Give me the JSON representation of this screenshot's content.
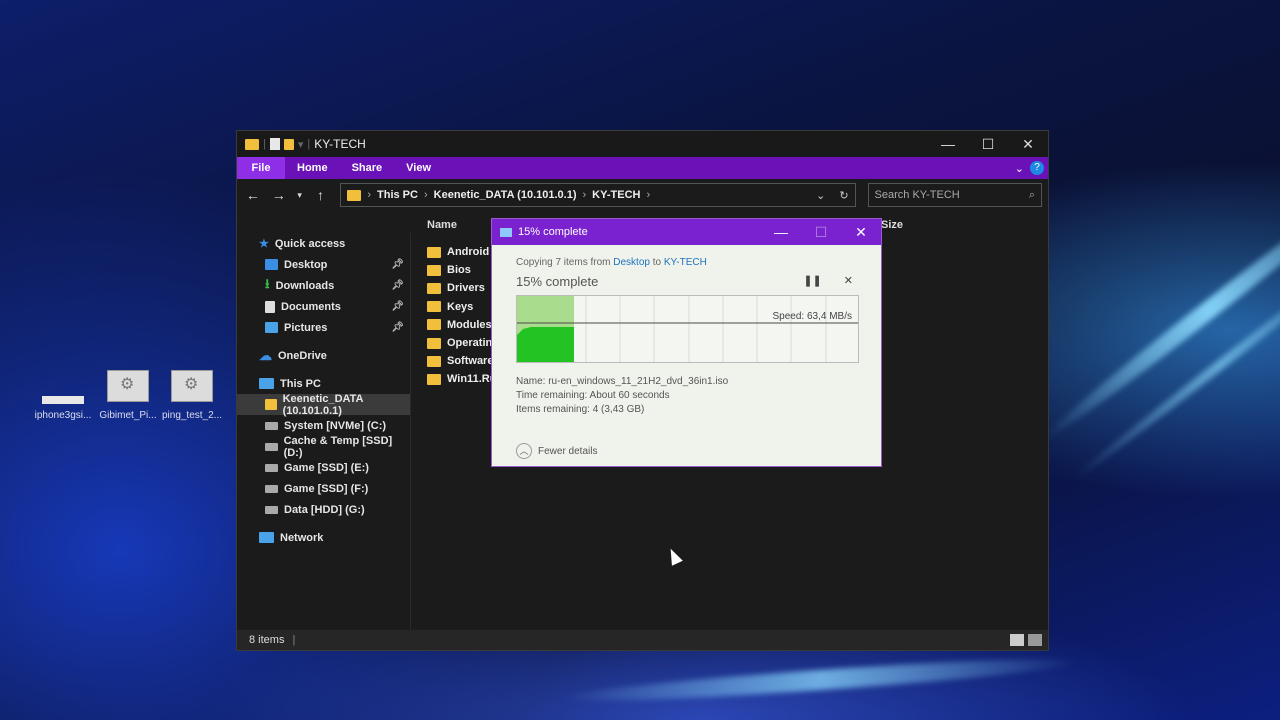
{
  "desktop": {
    "icons": [
      {
        "label": "iphone3gsi...",
        "icon": "file-icon"
      },
      {
        "label": "Gibimet_Pi...",
        "icon": "settings-file-icon"
      },
      {
        "label": "ping_test_2...",
        "icon": "settings-file-icon"
      }
    ]
  },
  "explorer": {
    "title": "KY-TECH",
    "ribbon": {
      "tabs": [
        "File",
        "Home",
        "Share",
        "View"
      ]
    },
    "address": {
      "crumbs": [
        "This PC",
        "Keenetic_DATA (10.101.0.1)",
        "KY-TECH"
      ]
    },
    "search": {
      "placeholder": "Search KY-TECH"
    },
    "nav": {
      "quick_access": "Quick access",
      "quick_items": [
        "Desktop",
        "Downloads",
        "Documents",
        "Pictures"
      ],
      "onedrive": "OneDrive",
      "this_pc": "This PC",
      "drives": [
        "Keenetic_DATA (10.101.0.1)",
        "System [NVMe] (C:)",
        "Cache & Temp [SSD] (D:)",
        "Game [SSD] (E:)",
        "Game [SSD] (F:)",
        "Data [HDD] (G:)"
      ],
      "network": "Network"
    },
    "columns": {
      "name": "Name",
      "size": "Size"
    },
    "files": [
      "Android",
      "Bios",
      "Drivers",
      "Keys",
      "Modules",
      "Operating",
      "Software",
      "Win11.Rus"
    ],
    "status": {
      "count": "8 items"
    }
  },
  "copy_dialog": {
    "title": "15% complete",
    "copying": {
      "prefix": "Copying 7 items from",
      "from": "Desktop",
      "to_word": "to",
      "to": "KY-TECH"
    },
    "percent_text": "15% complete",
    "progress": 0.15,
    "speed": "Speed: 63,4 MB/s",
    "name": "Name:  ru-en_windows_11_21H2_dvd_36in1.iso",
    "time_remaining": "Time remaining:  About 60 seconds",
    "items_remaining": "Items remaining:  4 (3,43 GB)",
    "fewer_details": "Fewer details"
  },
  "colors": {
    "accent": "#7a22d0",
    "progress_green": "#22c322",
    "folder": "#f2bf3c"
  }
}
